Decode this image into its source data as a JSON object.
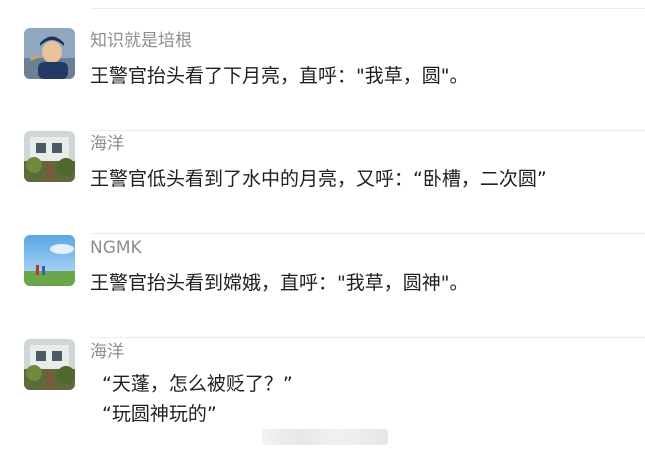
{
  "comments": [
    {
      "avatar_icon": "boy-cap-avatar-icon",
      "name": "知识就是培根",
      "text": "王警官抬头看了下月亮，直呼：\"我草，圆\"。"
    },
    {
      "avatar_icon": "house-garden-avatar-icon",
      "name": "海洋",
      "text": "王警官低头看到了水中的月亮，又呼：“卧槽，二次圆”"
    },
    {
      "avatar_icon": "sky-field-avatar-icon",
      "name": "NGMK",
      "text": "王警官抬头看到嫦娥，直呼：\"我草，圆神\"。"
    },
    {
      "avatar_icon": "house-garden-avatar-icon",
      "name": "海洋",
      "lines": [
        "“天蓬，怎么被贬了？”",
        "“玩圆神玩的”"
      ]
    }
  ],
  "colors": {
    "name": "#8e8e8e",
    "text": "#1f1f1f",
    "divider": "#ececec"
  }
}
